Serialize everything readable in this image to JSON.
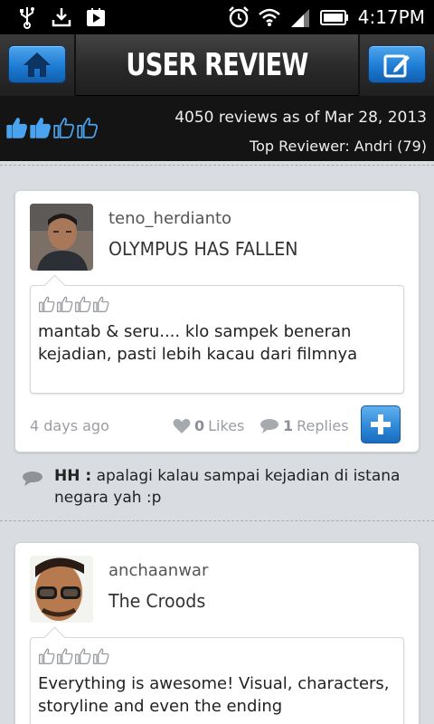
{
  "status_bar": {
    "left_icons": [
      "usb-icon",
      "download-icon",
      "play-store-icon"
    ],
    "right_icons": [
      "alarm-icon",
      "wifi-icon",
      "signal-icon",
      "battery-icon"
    ],
    "time": "4:17PM"
  },
  "header": {
    "title": "USER REVIEW",
    "home_icon": "home-icon",
    "write_icon": "edit-icon"
  },
  "summary": {
    "rating_thumbs": 4,
    "rating_filled": 2,
    "reviews_text": "4050 reviews as of Mar 28, 2013",
    "top_reviewer_text": "Top Reviewer: Andri (79)"
  },
  "reviews": [
    {
      "username": "teno_herdianto",
      "movie": "OLYMPUS HAS FALLEN",
      "rating_thumbs": 4,
      "text": "mantab & seru.... klo sampek beneran kejadian, pasti lebih kacau dari filmnya",
      "age": "4 days ago",
      "likes_count": "0",
      "likes_label": "Likes",
      "replies_count": "1",
      "replies_label": "Replies",
      "reply": {
        "author": "HH :",
        "text": "apalagi kalau sampai kejadian di istana negara yah :p"
      }
    },
    {
      "username": "anchaanwar",
      "movie": "The Croods",
      "rating_thumbs": 4,
      "text": "Everything is awesome! Visual, characters, storyline and even the ending"
    }
  ],
  "colors": {
    "accent_blue": "#1b79d1",
    "header_dark": "#2b2b2b",
    "page_bg": "#d9dce1"
  }
}
